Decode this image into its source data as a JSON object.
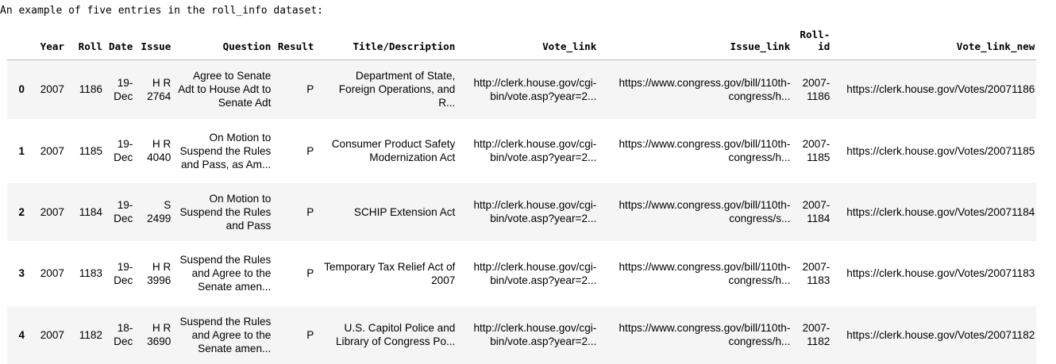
{
  "caption": "An example of five entries in the roll_info dataset:",
  "columns": [
    "",
    "Year",
    "Roll",
    "Date",
    "Issue",
    "Question",
    "Result",
    "Title/Description",
    "Vote_link",
    "Issue_link",
    "Roll-id",
    "Vote_link_new"
  ],
  "rows": [
    [
      "0",
      "2007",
      "1186",
      "19-Dec",
      "H R 2764",
      "Agree to Senate Adt to House Adt to Senate Adt",
      "P",
      "Department of State, Foreign Operations, and R...",
      "http://clerk.house.gov/cgi-bin/vote.asp?year=2...",
      "https://www.congress.gov/bill/110th-congress/h...",
      "2007-1186",
      "https://clerk.house.gov/Votes/20071186"
    ],
    [
      "1",
      "2007",
      "1185",
      "19-Dec",
      "H R 4040",
      "On Motion to Suspend the Rules and Pass, as Am...",
      "P",
      "Consumer Product Safety Modernization Act",
      "http://clerk.house.gov/cgi-bin/vote.asp?year=2...",
      "https://www.congress.gov/bill/110th-congress/h...",
      "2007-1185",
      "https://clerk.house.gov/Votes/20071185"
    ],
    [
      "2",
      "2007",
      "1184",
      "19-Dec",
      "S 2499",
      "On Motion to Suspend the Rules and Pass",
      "P",
      "SCHIP Extension Act",
      "http://clerk.house.gov/cgi-bin/vote.asp?year=2...",
      "https://www.congress.gov/bill/110th-congress/s...",
      "2007-1184",
      "https://clerk.house.gov/Votes/20071184"
    ],
    [
      "3",
      "2007",
      "1183",
      "19-Dec",
      "H R 3996",
      "Suspend the Rules and Agree to the Senate amen...",
      "P",
      "Temporary Tax Relief Act of 2007",
      "http://clerk.house.gov/cgi-bin/vote.asp?year=2...",
      "https://www.congress.gov/bill/110th-congress/h...",
      "2007-1183",
      "https://clerk.house.gov/Votes/20071183"
    ],
    [
      "4",
      "2007",
      "1182",
      "18-Dec",
      "H R 3690",
      "Suspend the Rules and Agree to the Senate amen...",
      "P",
      "U.S. Capitol Police and Library of Congress Po...",
      "http://clerk.house.gov/cgi-bin/vote.asp?year=2...",
      "https://www.congress.gov/bill/110th-congress/h...",
      "2007-1182",
      "https://clerk.house.gov/Votes/20071182"
    ]
  ]
}
